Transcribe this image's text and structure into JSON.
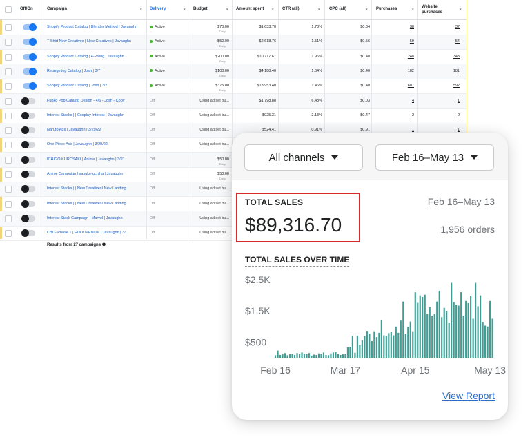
{
  "ads": {
    "columns": [
      {
        "label": "Off/On"
      },
      {
        "label": "Campaign"
      },
      {
        "label": "Delivery ↑"
      },
      {
        "label": "Budget"
      },
      {
        "label": "Amount spent"
      },
      {
        "label": "CTR (all)"
      },
      {
        "label": "CPC (all)"
      },
      {
        "label": "Purchases"
      },
      {
        "label": "Website purchases"
      }
    ],
    "rows": [
      {
        "on": true,
        "campaign": "Shopify Product Catalog | Blender Method | Javaughn",
        "delivery": "Active",
        "budget": "$70.00",
        "budget_sub": "Daily",
        "spent": "$1,633.70",
        "ctr": "1.73%",
        "cpc": "$0.34",
        "purchases": "38",
        "web_purchases": "37"
      },
      {
        "on": true,
        "campaign": "T-Shirt New Creatives | New Creatives | Javaughn",
        "delivery": "Active",
        "budget": "$50.00",
        "budget_sub": "Daily",
        "spent": "$2,618.76",
        "ctr": "1.51%",
        "cpc": "$0.56",
        "purchases": "59",
        "web_purchases": "54"
      },
      {
        "on": true,
        "campaign": "Shopify Product Catalog | 4-Prong | Javaughn",
        "delivery": "Active",
        "budget": "$200.00",
        "budget_sub": "Daily",
        "spent": "$10,717.67",
        "ctr": "1.96%",
        "cpc": "$0.40",
        "purchases": "248",
        "web_purchases": "343"
      },
      {
        "on": true,
        "campaign": "Retargeting Catalog | Josh | 3/7",
        "delivery": "Active",
        "budget": "$100.00",
        "budget_sub": "Daily",
        "spent": "$4,188.40",
        "ctr": "1.64%",
        "cpc": "$0.40",
        "purchases": "182",
        "web_purchases": "181"
      },
      {
        "on": true,
        "campaign": "Shopify Product Catalog | Josh | 3/7",
        "delivery": "Active",
        "budget": "$375.00",
        "budget_sub": "Daily",
        "spent": "$18,953.40",
        "ctr": "1.46%",
        "cpc": "$0.40",
        "purchases": "607",
        "web_purchases": "592"
      },
      {
        "on": false,
        "campaign": "Funko Pop Catalog Design - 4/6 - Josh - Copy",
        "delivery": "Off",
        "budget": "Using ad set bu...",
        "budget_sub": "",
        "spent": "$1,798.88",
        "ctr": "6.48%",
        "cpc": "$0.03",
        "purchases": "4",
        "web_purchases": "1"
      },
      {
        "on": false,
        "campaign": "Interest Stacks | | Cosplay Interest | Javaughn",
        "delivery": "Off",
        "budget": "Using ad set bu...",
        "budget_sub": "",
        "spent": "$925.31",
        "ctr": "2.13%",
        "cpc": "$0.47",
        "purchases": "2",
        "web_purchases": "2"
      },
      {
        "on": false,
        "campaign": "Naruto Ads | Javaughn | 3/29/22",
        "delivery": "Off",
        "budget": "Using ad set bu...",
        "budget_sub": "",
        "spent": "$524.41",
        "ctr": "0.91%",
        "cpc": "$0.91",
        "purchases": "1",
        "web_purchases": "1"
      },
      {
        "on": false,
        "campaign": "One-Piece Ads | Javaughn | 3/29/22",
        "delivery": "Off",
        "budget": "Using ad set bu...",
        "budget_sub": "",
        "spent": "",
        "ctr": "",
        "cpc": "",
        "purchases": "",
        "web_purchases": ""
      },
      {
        "on": false,
        "campaign": "ICHIGO KUROSAKI | Anime | Javaughn | 3/21",
        "delivery": "Off",
        "budget": "$50.00",
        "budget_sub": "Daily",
        "spent": "",
        "ctr": "",
        "cpc": "",
        "purchases": "",
        "web_purchases": ""
      },
      {
        "on": false,
        "campaign": "Anime Campaign | sasuke-uchiha | Javaughn",
        "delivery": "Off",
        "budget": "$50.00",
        "budget_sub": "Daily",
        "spent": "",
        "ctr": "",
        "cpc": "",
        "purchases": "",
        "web_purchases": ""
      },
      {
        "on": false,
        "campaign": "Interest Stacks | | New Creatives/ New Landing",
        "delivery": "Off",
        "budget": "Using ad set bu...",
        "budget_sub": "",
        "spent": "",
        "ctr": "",
        "cpc": "",
        "purchases": "",
        "web_purchases": ""
      },
      {
        "on": false,
        "campaign": "Interest Stacks | | New Creatives/ New Landing",
        "delivery": "Off",
        "budget": "Using ad set bu...",
        "budget_sub": "",
        "spent": "",
        "ctr": "",
        "cpc": "",
        "purchases": "",
        "web_purchases": ""
      },
      {
        "on": false,
        "campaign": "Interest Stack Campaign | Marvel | Javaughn",
        "delivery": "Off",
        "budget": "Using ad set bu...",
        "budget_sub": "",
        "spent": "",
        "ctr": "",
        "cpc": "",
        "purchases": "",
        "web_purchases": ""
      },
      {
        "on": false,
        "campaign": "CBO- Phase 1 | HULK/VENOM | Javaughn | 3/...",
        "delivery": "Off",
        "budget": "Using ad set bu...",
        "budget_sub": "",
        "spent": "",
        "ctr": "",
        "cpc": "",
        "purchases": "",
        "web_purchases": ""
      }
    ],
    "footer": "Results from 27 campaigns ❶"
  },
  "sales": {
    "channel_select": "All channels",
    "date_select": "Feb 16–May 13",
    "total_label": "TOTAL SALES",
    "range_label": "Feb 16–May 13",
    "total_value": "$89,316.70",
    "orders": "1,956 orders",
    "over_time_label": "TOTAL SALES OVER TIME",
    "view_report": "View Report",
    "accent": "#3f9e94",
    "highlight": "#d82c2c"
  },
  "chart_data": {
    "type": "bar",
    "ytick_labels": [
      "$2.5K",
      "$1.5K",
      "$500"
    ],
    "ytick_values": [
      2500,
      1500,
      500
    ],
    "xtick_labels": [
      "Feb 16",
      "Mar 17",
      "Apr 15",
      "May 13"
    ],
    "xtick_index": [
      0,
      29,
      58,
      86
    ],
    "ylim": [
      0,
      2700
    ],
    "values": [
      80,
      230,
      90,
      110,
      150,
      80,
      120,
      130,
      90,
      150,
      110,
      170,
      120,
      110,
      150,
      70,
      100,
      90,
      140,
      120,
      170,
      90,
      80,
      140,
      170,
      180,
      120,
      90,
      110,
      110,
      340,
      350,
      700,
      160,
      710,
      400,
      560,
      690,
      860,
      770,
      530,
      850,
      660,
      800,
      1200,
      720,
      700,
      790,
      840,
      720,
      1000,
      800,
      1190,
      1800,
      770,
      990,
      1160,
      850,
      2100,
      1760,
      2000,
      1950,
      2020,
      1400,
      1620,
      1350,
      1400,
      1800,
      2150,
      1300,
      1600,
      1500,
      1130,
      2400,
      1780,
      1700,
      1670,
      2100,
      1350,
      1820,
      1750,
      1990,
      1250,
      2400,
      1650,
      2000,
      1150,
      1030,
      1000,
      1820,
      1250
    ]
  }
}
